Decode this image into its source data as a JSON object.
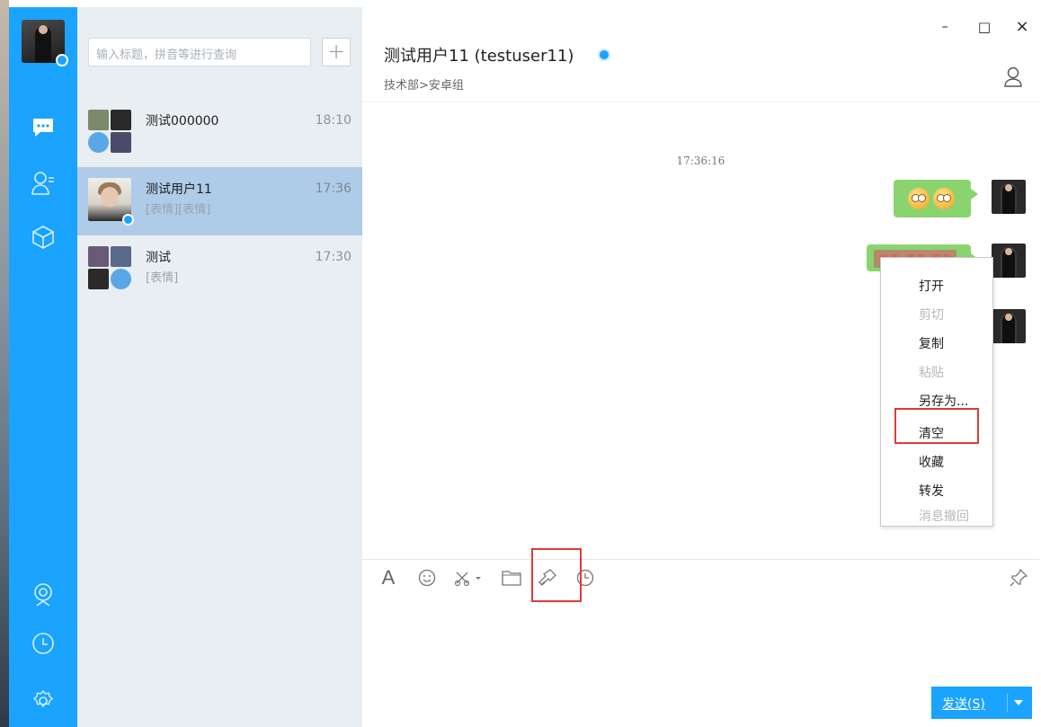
{
  "window": {
    "minimize": "–",
    "maximize": "□",
    "close": "×"
  },
  "search": {
    "placeholder": "输入标题，拼音等进行查询",
    "add_label": "+"
  },
  "conversations": [
    {
      "title": "测试000000",
      "time": "18:10",
      "preview": ""
    },
    {
      "title": "测试用户11",
      "time": "17:36",
      "preview": "[表情][表情]"
    },
    {
      "title": "测试",
      "time": "17:30",
      "preview": "[表情]"
    }
  ],
  "chat": {
    "title": "测试用户11 (testuser11)",
    "subtitle": "技术部>安卓组",
    "timestamp": "17:36:16"
  },
  "context_menu": [
    {
      "label": "打开",
      "disabled": false
    },
    {
      "label": "剪切",
      "disabled": true
    },
    {
      "label": "复制",
      "disabled": false
    },
    {
      "label": "粘贴",
      "disabled": true
    },
    {
      "label": "另存为...",
      "disabled": false
    },
    {
      "label": "清空",
      "disabled": false
    },
    {
      "label": "收藏",
      "disabled": false
    },
    {
      "label": "转发",
      "disabled": false
    },
    {
      "label": "消息撤回",
      "disabled": true
    }
  ],
  "toolbar": {
    "icons": [
      "font-icon",
      "emoji-icon",
      "screenshot-icon",
      "folder-icon",
      "clear-brush-icon",
      "history-icon",
      "pin-icon"
    ],
    "font_glyph": "A"
  },
  "send": {
    "label": "发送(S)"
  },
  "colors": {
    "accent": "#1aa3ff",
    "bubble": "#8ad46f",
    "highlight": "#e03a3a",
    "active_row": "#aecbe8"
  }
}
